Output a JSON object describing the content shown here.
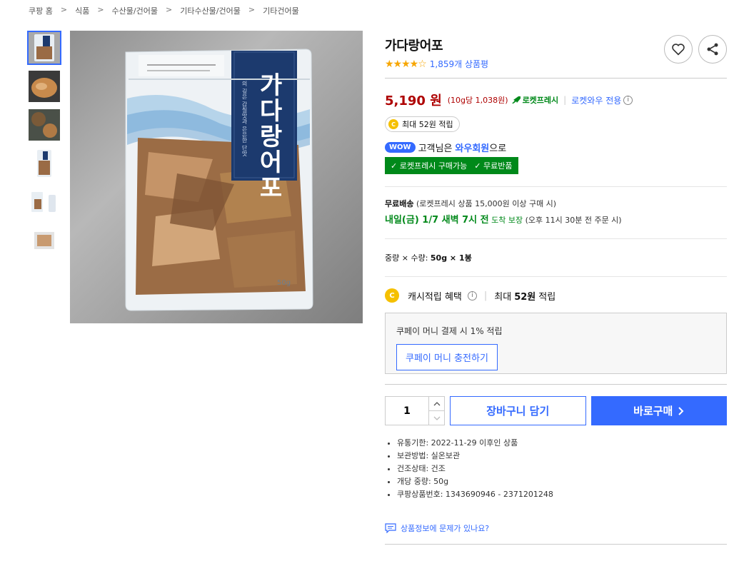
{
  "breadcrumb": [
    "쿠팡 홈",
    "식품",
    "수산물/건어물",
    "기타수산물/건어물",
    "기타건어물"
  ],
  "breadcrumb_sep": ">",
  "product": {
    "title": "가다랑어포",
    "rating_stars": "★★★★☆",
    "rating_value": 4.5,
    "review_count": "1,859개 상품평",
    "price": "5,190 원",
    "unit_price": "(10g당 1,038원)",
    "rocket_label": "로켓프레시",
    "wow_only": "로켓와우 전용",
    "cash_badge": "최대 52원 적립",
    "wow_pill": "WOW",
    "wow_customer": "고객님은",
    "wow_member": "와우회원",
    "wow_suffix": "으로",
    "wow_benefit_1": "로켓프레시 구매가능",
    "wow_benefit_2": "무료반품",
    "package_text": "가다랑어포",
    "package_tagline": "의 깊은 감칠맛과 은은한 단맛",
    "package_weight": "50g"
  },
  "shipping": {
    "free_label": "무료배송",
    "free_detail": "(로켓프레시 상품 15,000원 이상 구매 시)",
    "arrive": "내일(금) 1/7 새벽 7시 전",
    "arrive_suffix": "도착 보장",
    "cutoff": "(오후 11시 30분 전 주문 시)"
  },
  "option": {
    "label": "중량 × 수량:",
    "value": "50g × 1봉"
  },
  "cash": {
    "label": "캐시적립 혜택",
    "max": "최대",
    "amount": "52원",
    "suffix": "적립"
  },
  "coupay": {
    "text": "쿠페이 머니 결제 시 1% 적립",
    "button": "쿠페이 머니 충전하기"
  },
  "buy": {
    "quantity": "1",
    "cart": "장바구니 담기",
    "buy_now": "바로구매"
  },
  "details": [
    "유통기한: 2022-11-29 이후인 상품",
    "보관방법: 실온보관",
    "건조상태: 건조",
    "개당 중량: 50g",
    "쿠팡상품번호: 1343690946 - 2371201248"
  ],
  "report": "상품정보에 문제가 있나요?",
  "colors": {
    "accent": "#346aff",
    "price": "#ae0000",
    "rocket_green": "#00891a",
    "star": "#f7a600"
  },
  "icons": [
    "heart-icon",
    "share-icon",
    "rocket-icon",
    "info-icon",
    "coin-icon",
    "check-icon",
    "chevron-up-icon",
    "chevron-down-icon",
    "chevron-right-icon",
    "message-icon"
  ]
}
